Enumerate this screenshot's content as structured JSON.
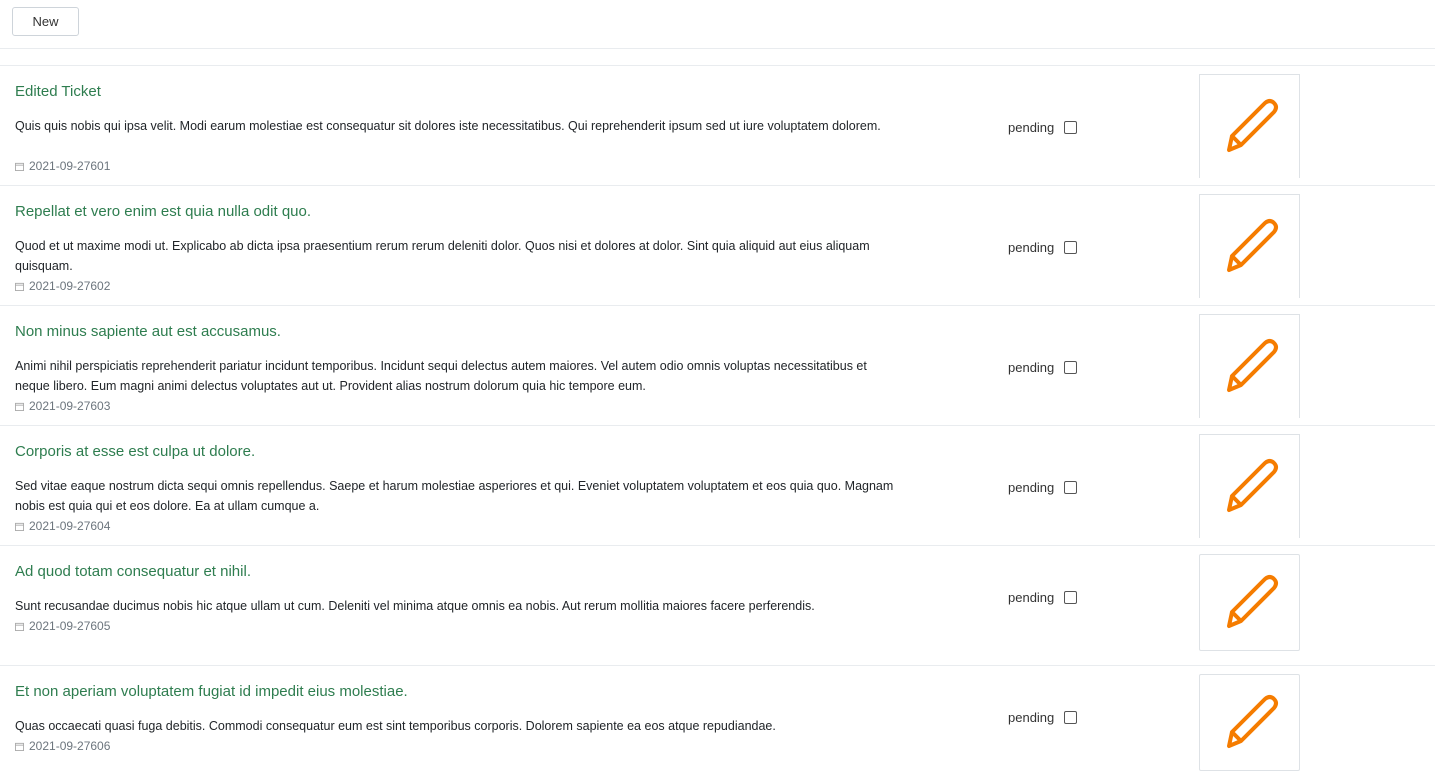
{
  "toolbar": {
    "new_label": "New"
  },
  "colors": {
    "title": "#2e7d4f",
    "pencil": "#f57c00"
  },
  "icons": {
    "edit": "pencil-icon",
    "date": "calendar-icon"
  },
  "tickets": [
    {
      "title": "Edited Ticket",
      "description": "Quis quis nobis qui ipsa velit. Modi earum molestiae est consequatur sit dolores iste necessitatibus. Qui reprehenderit ipsum sed ut iure voluptatem dolorem.",
      "date": "2021-09-27601",
      "status": "pending",
      "checked": false
    },
    {
      "title": "Repellat et vero enim est quia nulla odit quo.",
      "description": "Quod et ut maxime modi ut. Explicabo ab dicta ipsa praesentium rerum rerum deleniti dolor. Quos nisi et dolores at dolor. Sint quia aliquid aut eius aliquam quisquam.",
      "date": "2021-09-27602",
      "status": "pending",
      "checked": false
    },
    {
      "title": "Non minus sapiente aut est accusamus.",
      "description": "Animi nihil perspiciatis reprehenderit pariatur incidunt temporibus. Incidunt sequi delectus autem maiores. Vel autem odio omnis voluptas necessitatibus et neque libero. Eum magni animi delectus voluptates aut ut. Provident alias nostrum dolorum quia hic tempore eum.",
      "date": "2021-09-27603",
      "status": "pending",
      "checked": false
    },
    {
      "title": "Corporis at esse est culpa ut dolore.",
      "description": "Sed vitae eaque nostrum dicta sequi omnis repellendus. Saepe et harum molestiae asperiores et qui. Eveniet voluptatem voluptatem et eos quia quo. Magnam nobis est quia qui et eos dolore. Ea at ullam cumque a.",
      "date": "2021-09-27604",
      "status": "pending",
      "checked": false
    },
    {
      "title": "Ad quod totam consequatur et nihil.",
      "description": "Sunt recusandae ducimus nobis hic atque ullam ut cum. Deleniti vel minima atque omnis ea nobis. Aut rerum mollitia maiores facere perferendis.",
      "date": "2021-09-27605",
      "status": "pending",
      "checked": false
    },
    {
      "title": "Et non aperiam voluptatem fugiat id impedit eius molestiae.",
      "description": "Quas occaecati quasi fuga debitis. Commodi consequatur eum est sint temporibus corporis. Dolorem sapiente ea eos atque repudiandae.",
      "date": "2021-09-27606",
      "status": "pending",
      "checked": false
    }
  ]
}
